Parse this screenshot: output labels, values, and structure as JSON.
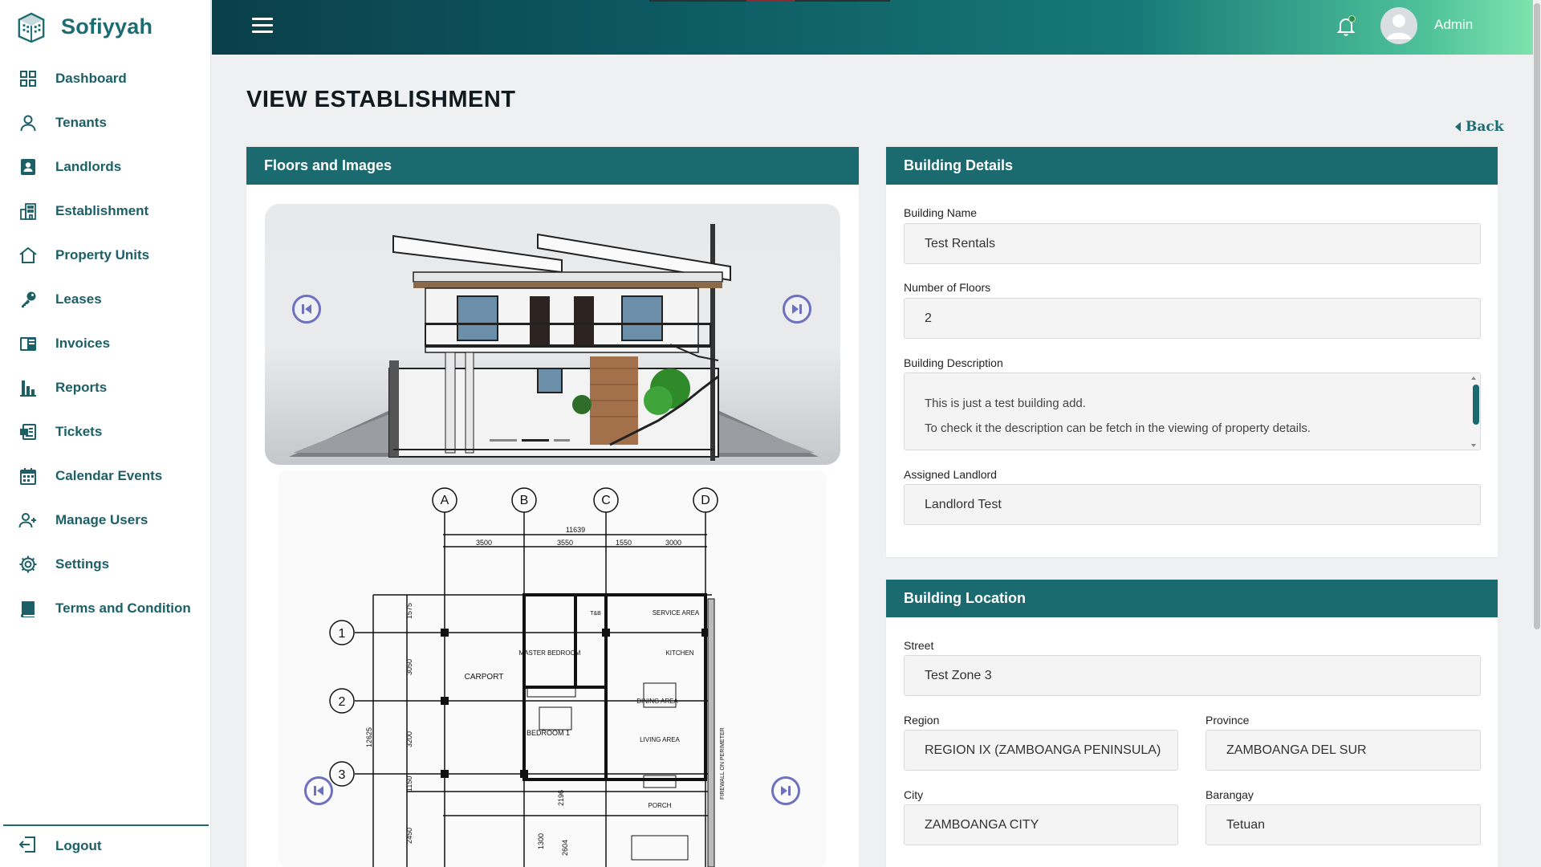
{
  "brand": {
    "name": "Sofiyyah"
  },
  "sidebar": {
    "items": [
      {
        "label": "Dashboard",
        "icon": "dashboard-grid-icon"
      },
      {
        "label": "Tenants",
        "icon": "user-icon"
      },
      {
        "label": "Landlords",
        "icon": "id-badge-icon"
      },
      {
        "label": "Establishment",
        "icon": "building-icon"
      },
      {
        "label": "Property Units",
        "icon": "home-icon"
      },
      {
        "label": "Leases",
        "icon": "key-icon"
      },
      {
        "label": "Invoices",
        "icon": "invoice-icon"
      },
      {
        "label": "Reports",
        "icon": "bar-chart-icon"
      },
      {
        "label": "Tickets",
        "icon": "ticket-icon"
      },
      {
        "label": "Calendar Events",
        "icon": "calendar-icon"
      },
      {
        "label": "Manage Users",
        "icon": "user-plus-icon"
      },
      {
        "label": "Settings",
        "icon": "gear-icon"
      },
      {
        "label": "Terms and Condition",
        "icon": "book-icon"
      }
    ],
    "logout_label": "Logout"
  },
  "topbar": {
    "user_name": "Admin"
  },
  "page": {
    "title": "VIEW ESTABLISHMENT",
    "back_label": "Back"
  },
  "floors": {
    "header": "Floors and Images",
    "plan_labels": {
      "columns": [
        "A",
        "B",
        "C",
        "D"
      ],
      "rows": [
        "1",
        "2",
        "3"
      ],
      "total_width": "11639",
      "spans": [
        "3500",
        "3550",
        "1550",
        "3000"
      ],
      "rooms": [
        "CARPORT",
        "MASTER BEDROOM",
        "BEDROOM 1",
        "KITCHEN",
        "DINING AREA",
        "LIVING AREA",
        "SERVICE AREA",
        "PORCH",
        "T&B"
      ],
      "side_dims": [
        "1575",
        "3050",
        "3200",
        "1150",
        "2450",
        "12625",
        "2196",
        "1300",
        "2604"
      ],
      "firewall": "FIREWALL ON PERIMETER"
    }
  },
  "building_details": {
    "header": "Building Details",
    "name_label": "Building Name",
    "name_value": "Test Rentals",
    "floors_label": "Number of Floors",
    "floors_value": "2",
    "description_label": "Building Description",
    "description_line1": "This is just a test building add.",
    "description_line2": "To check it the description can be fetch in the viewing of property details.",
    "landlord_label": "Assigned Landlord",
    "landlord_value": "Landlord Test"
  },
  "building_location": {
    "header": "Building Location",
    "street_label": "Street",
    "street_value": "Test Zone 3",
    "region_label": "Region",
    "region_value": "REGION IX (ZAMBOANGA PENINSULA)",
    "province_label": "Province",
    "province_value": "ZAMBOANGA DEL SUR",
    "city_label": "City",
    "city_value": "ZAMBOANGA CITY",
    "barangay_label": "Barangay",
    "barangay_value": "Tetuan"
  },
  "colors": {
    "primary": "#1b6a70",
    "sidebar_text": "#1c5f67",
    "arrow": "#6e70c0"
  }
}
